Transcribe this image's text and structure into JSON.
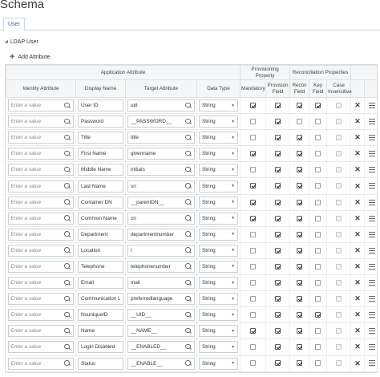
{
  "page": {
    "title": "Schema"
  },
  "tabs": [
    {
      "label": "User"
    }
  ],
  "section": {
    "label": "LDAP User"
  },
  "toolbar": {
    "add_label": "Add Attribute"
  },
  "table": {
    "groups": {
      "application": "Application Attribute",
      "provisioning": "Provisioning Property",
      "reconciliation": "Reconciliation Properties"
    },
    "columns": {
      "identity": "Identity Attribute",
      "display": "Display Name",
      "target": "Target Attribute",
      "datatype": "Data Type",
      "mandatory": "Mandatory",
      "provision_field": "Provision Field",
      "recon_field": "Recon Field",
      "key_field": "Key Field",
      "case_insensitive": "Case Insensitive"
    },
    "identity_placeholder": "Enter a value",
    "rows": [
      {
        "display": "User ID",
        "target": "uid",
        "type": "String",
        "mandatory": true,
        "provision": true,
        "recon": true,
        "key": true,
        "case": false
      },
      {
        "display": "Password",
        "target": "__PASSWORD__",
        "type": "String",
        "mandatory": false,
        "provision": true,
        "recon": false,
        "key": false,
        "case": false
      },
      {
        "display": "Title",
        "target": "title",
        "type": "String",
        "mandatory": false,
        "provision": true,
        "recon": true,
        "key": false,
        "case": false
      },
      {
        "display": "First Name",
        "target": "givenname",
        "type": "String",
        "mandatory": true,
        "provision": true,
        "recon": true,
        "key": false,
        "case": false
      },
      {
        "display": "Middle Name",
        "target": "initials",
        "type": "String",
        "mandatory": false,
        "provision": true,
        "recon": true,
        "key": false,
        "case": false
      },
      {
        "display": "Last Name",
        "target": "sn",
        "type": "String",
        "mandatory": true,
        "provision": true,
        "recon": true,
        "key": false,
        "case": false
      },
      {
        "display": "Container DN",
        "target": "__parentDN__",
        "type": "String",
        "mandatory": true,
        "provision": true,
        "recon": true,
        "key": false,
        "case": false
      },
      {
        "display": "Common Name",
        "target": "cn",
        "type": "String",
        "mandatory": true,
        "provision": true,
        "recon": true,
        "key": false,
        "case": false
      },
      {
        "display": "Department",
        "target": "departmentnumber",
        "type": "String",
        "mandatory": false,
        "provision": true,
        "recon": true,
        "key": false,
        "case": false
      },
      {
        "display": "Location",
        "target": "l",
        "type": "String",
        "mandatory": false,
        "provision": true,
        "recon": true,
        "key": false,
        "case": false
      },
      {
        "display": "Telephone",
        "target": "telephonenumber",
        "type": "String",
        "mandatory": false,
        "provision": true,
        "recon": true,
        "key": false,
        "case": false
      },
      {
        "display": "Email",
        "target": "mail",
        "type": "String",
        "mandatory": false,
        "provision": true,
        "recon": true,
        "key": false,
        "case": false
      },
      {
        "display": "Communication Lan",
        "target": "preferredlanguage",
        "type": "String",
        "mandatory": false,
        "provision": true,
        "recon": true,
        "key": false,
        "case": false
      },
      {
        "display": "NsuniqueID",
        "target": "__UID__",
        "type": "String",
        "mandatory": false,
        "provision": true,
        "recon": true,
        "key": true,
        "case": false
      },
      {
        "display": "Name",
        "target": "__NAME__",
        "type": "String",
        "mandatory": true,
        "provision": true,
        "recon": true,
        "key": false,
        "case": false
      },
      {
        "display": "Login Disabled",
        "target": "__ENABLED__",
        "type": "String",
        "mandatory": false,
        "provision": true,
        "recon": true,
        "key": false,
        "case": false
      },
      {
        "display": "Status",
        "target": "__ENABLE__",
        "type": "String",
        "mandatory": false,
        "provision": true,
        "recon": true,
        "key": false,
        "case": false
      }
    ]
  },
  "icons": {
    "search": "search-icon",
    "delete": "close-icon",
    "menu": "hamburger-menu-icon",
    "add": "plus-icon",
    "collapse": "triangle-down-icon",
    "dropdown": "chevron-down-icon"
  }
}
